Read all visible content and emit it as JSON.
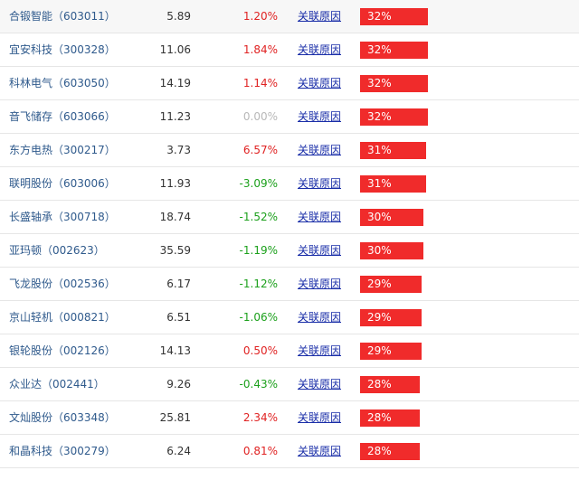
{
  "reason_link_label": "关联原因",
  "rows": [
    {
      "name": "合锻智能（603011）",
      "price": "5.89",
      "change": "1.20%",
      "trend": "up",
      "pct": "32%",
      "level": 32
    },
    {
      "name": "宜安科技（300328）",
      "price": "11.06",
      "change": "1.84%",
      "trend": "up",
      "pct": "32%",
      "level": 32
    },
    {
      "name": "科林电气（603050）",
      "price": "14.19",
      "change": "1.14%",
      "trend": "up",
      "pct": "32%",
      "level": 32
    },
    {
      "name": "音飞储存（603066）",
      "price": "11.23",
      "change": "0.00%",
      "trend": "flat",
      "pct": "32%",
      "level": 32
    },
    {
      "name": "东方电热（300217）",
      "price": "3.73",
      "change": "6.57%",
      "trend": "up",
      "pct": "31%",
      "level": 31
    },
    {
      "name": "联明股份（603006）",
      "price": "11.93",
      "change": "-3.09%",
      "trend": "down",
      "pct": "31%",
      "level": 31
    },
    {
      "name": "长盛轴承（300718）",
      "price": "18.74",
      "change": "-1.52%",
      "trend": "down",
      "pct": "30%",
      "level": 30
    },
    {
      "name": "亚玛顿（002623）",
      "price": "35.59",
      "change": "-1.19%",
      "trend": "down",
      "pct": "30%",
      "level": 30
    },
    {
      "name": "飞龙股份（002536）",
      "price": "6.17",
      "change": "-1.12%",
      "trend": "down",
      "pct": "29%",
      "level": 29
    },
    {
      "name": "京山轻机（000821）",
      "price": "6.51",
      "change": "-1.06%",
      "trend": "down",
      "pct": "29%",
      "level": 29
    },
    {
      "name": "银轮股份（002126）",
      "price": "14.13",
      "change": "0.50%",
      "trend": "up",
      "pct": "29%",
      "level": 29
    },
    {
      "name": "众业达（002441）",
      "price": "9.26",
      "change": "-0.43%",
      "trend": "down",
      "pct": "28%",
      "level": 28
    },
    {
      "name": "文灿股份（603348）",
      "price": "25.81",
      "change": "2.34%",
      "trend": "up",
      "pct": "28%",
      "level": 28
    },
    {
      "name": "和晶科技（300279）",
      "price": "6.24",
      "change": "0.81%",
      "trend": "up",
      "pct": "28%",
      "level": 28
    }
  ]
}
